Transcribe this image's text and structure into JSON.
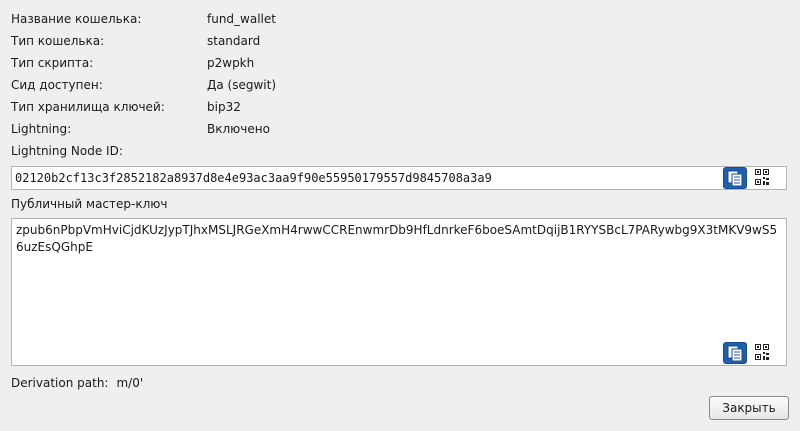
{
  "info": [
    {
      "label": "Название кошелька:",
      "value": "fund_wallet"
    },
    {
      "label": "Тип кошелька:",
      "value": "standard"
    },
    {
      "label": "Тип скрипта:",
      "value": "p2wpkh"
    },
    {
      "label": "Сид доступен:",
      "value": "Да (segwit)"
    },
    {
      "label": "Тип хранилища ключей:",
      "value": "bip32"
    },
    {
      "label": "Lightning:",
      "value": "Включено"
    }
  ],
  "node_id": {
    "label": "Lightning Node ID:",
    "value": "02120b2cf13c3f2852182a8937d8e4e93ac3aa9f90e55950179557d9845708a3a9"
  },
  "master_key": {
    "label": "Публичный мастер-ключ",
    "value": "zpub6nPbpVmHviCjdKUzJypTJhxMSLJRGeXmH4rwwCCREnwmrDb9HfLdnrkeF6boeSAmtDqijB1RYYSBcL7PARywbg9X3tMKV9wS56uzEsQGhpE"
  },
  "derivation": {
    "label": "Derivation path:",
    "value": "m/0'"
  },
  "buttons": {
    "close": "Закрыть"
  },
  "icons": {
    "copy": "copy-icon",
    "qr": "qr-code-icon"
  },
  "colors": {
    "background": "#efefef",
    "copy_button": "#1f5fb0"
  }
}
